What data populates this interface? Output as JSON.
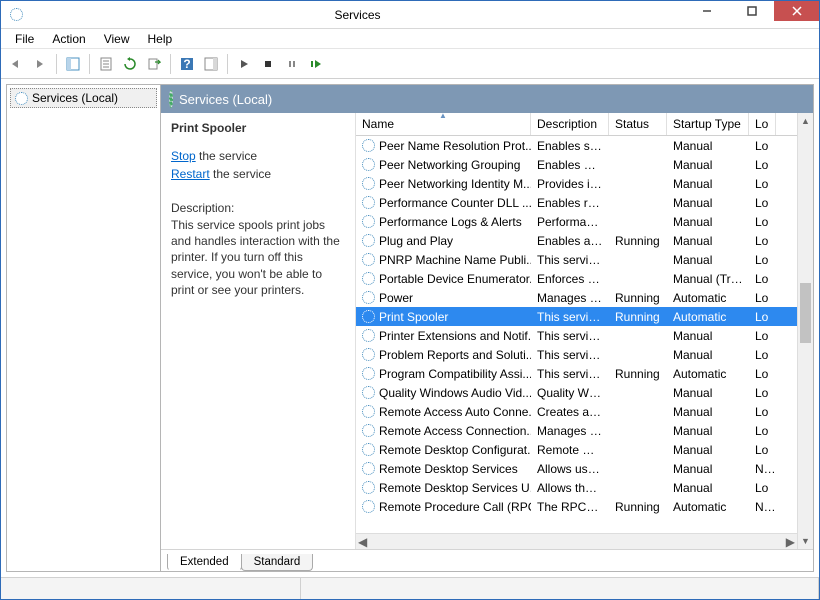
{
  "window": {
    "title": "Services"
  },
  "menu": {
    "file": "File",
    "action": "Action",
    "view": "View",
    "help": "Help"
  },
  "tree": {
    "root": "Services (Local)"
  },
  "header": {
    "label": "Services (Local)"
  },
  "detail": {
    "selected_name": "Print Spooler",
    "stop_label": "Stop",
    "stop_suffix": " the service",
    "restart_label": "Restart",
    "restart_suffix": " the service",
    "desc_heading": "Description:",
    "desc_text": "This service spools print jobs and handles interaction with the printer. If you turn off this service, you won't be able to print or see your printers."
  },
  "columns": {
    "name": "Name",
    "desc": "Description",
    "status": "Status",
    "startup": "Startup Type",
    "logon": "Lo"
  },
  "tabs": {
    "extended": "Extended",
    "standard": "Standard"
  },
  "services": [
    {
      "name": "Peer Name Resolution Prot...",
      "desc": "Enables serv...",
      "status": "",
      "startup": "Manual",
      "logon": "Lo"
    },
    {
      "name": "Peer Networking Grouping",
      "desc": "Enables mul...",
      "status": "",
      "startup": "Manual",
      "logon": "Lo"
    },
    {
      "name": "Peer Networking Identity M...",
      "desc": "Provides ide...",
      "status": "",
      "startup": "Manual",
      "logon": "Lo"
    },
    {
      "name": "Performance Counter DLL ...",
      "desc": "Enables rem...",
      "status": "",
      "startup": "Manual",
      "logon": "Lo"
    },
    {
      "name": "Performance Logs & Alerts",
      "desc": "Performanc...",
      "status": "",
      "startup": "Manual",
      "logon": "Lo"
    },
    {
      "name": "Plug and Play",
      "desc": "Enables a c...",
      "status": "Running",
      "startup": "Manual",
      "logon": "Lo"
    },
    {
      "name": "PNRP Machine Name Publi...",
      "desc": "This service ...",
      "status": "",
      "startup": "Manual",
      "logon": "Lo"
    },
    {
      "name": "Portable Device Enumerator...",
      "desc": "Enforces gr...",
      "status": "",
      "startup": "Manual (Trig...",
      "logon": "Lo"
    },
    {
      "name": "Power",
      "desc": "Manages p...",
      "status": "Running",
      "startup": "Automatic",
      "logon": "Lo"
    },
    {
      "name": "Print Spooler",
      "desc": "This service ...",
      "status": "Running",
      "startup": "Automatic",
      "logon": "Lo",
      "selected": true
    },
    {
      "name": "Printer Extensions and Notif...",
      "desc": "This service ...",
      "status": "",
      "startup": "Manual",
      "logon": "Lo"
    },
    {
      "name": "Problem Reports and Soluti...",
      "desc": "This service ...",
      "status": "",
      "startup": "Manual",
      "logon": "Lo"
    },
    {
      "name": "Program Compatibility Assi...",
      "desc": "This service ...",
      "status": "Running",
      "startup": "Automatic",
      "logon": "Lo"
    },
    {
      "name": "Quality Windows Audio Vid...",
      "desc": "Quality Win...",
      "status": "",
      "startup": "Manual",
      "logon": "Lo"
    },
    {
      "name": "Remote Access Auto Conne...",
      "desc": "Creates a co...",
      "status": "",
      "startup": "Manual",
      "logon": "Lo"
    },
    {
      "name": "Remote Access Connection...",
      "desc": "Manages di...",
      "status": "",
      "startup": "Manual",
      "logon": "Lo"
    },
    {
      "name": "Remote Desktop Configurat...",
      "desc": "Remote Des...",
      "status": "",
      "startup": "Manual",
      "logon": "Lo"
    },
    {
      "name": "Remote Desktop Services",
      "desc": "Allows user...",
      "status": "",
      "startup": "Manual",
      "logon": "Ne"
    },
    {
      "name": "Remote Desktop Services U...",
      "desc": "Allows the r...",
      "status": "",
      "startup": "Manual",
      "logon": "Lo"
    },
    {
      "name": "Remote Procedure Call (RPC)",
      "desc": "The RPCSS ...",
      "status": "Running",
      "startup": "Automatic",
      "logon": "Ne"
    }
  ]
}
